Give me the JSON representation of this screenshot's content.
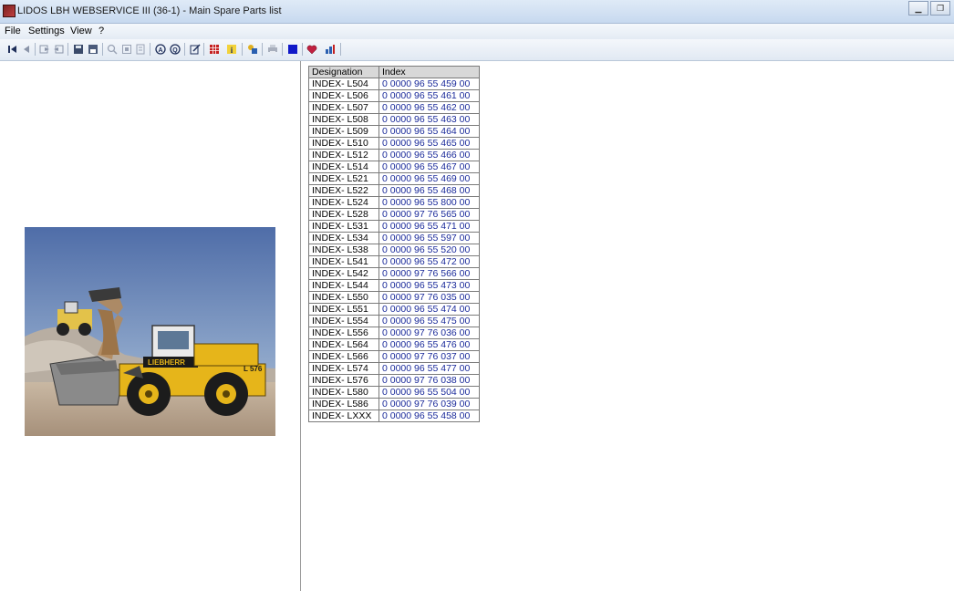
{
  "window": {
    "title": "LIDOS LBH WEBSERVICE III (36-1) - Main Spare Parts list"
  },
  "menu": {
    "file": "File",
    "settings": "Settings",
    "view": "View",
    "help": "?"
  },
  "icons": [
    "first-record-icon",
    "prev-record-icon",
    "export-icon",
    "import-icon",
    "save-icon",
    "floppy-icon",
    "zoom-icon",
    "fit-page-icon",
    "page-icon",
    "search-a-icon",
    "search-b-icon",
    "edit-icon",
    "grid-icon",
    "info-icon",
    "tools-icon",
    "print-icon",
    "stop-icon",
    "favorite-icon",
    "bookmark-icon"
  ],
  "table": {
    "headers": {
      "designation": "Designation",
      "index": "Index"
    },
    "rows": [
      {
        "designation": "INDEX- L504",
        "index": "0 0000  96 55 459 00"
      },
      {
        "designation": "INDEX- L506",
        "index": "0 0000  96 55 461 00"
      },
      {
        "designation": "INDEX- L507",
        "index": "0 0000  96 55 462 00"
      },
      {
        "designation": "INDEX- L508",
        "index": "0 0000  96 55 463 00"
      },
      {
        "designation": "INDEX- L509",
        "index": "0 0000  96 55 464 00"
      },
      {
        "designation": "INDEX- L510",
        "index": "0 0000  96 55 465 00"
      },
      {
        "designation": "INDEX- L512",
        "index": "0 0000  96 55 466 00"
      },
      {
        "designation": "INDEX- L514",
        "index": "0 0000  96 55 467 00"
      },
      {
        "designation": "INDEX- L521",
        "index": "0 0000  96 55 469 00"
      },
      {
        "designation": "INDEX- L522",
        "index": "0 0000  96 55 468 00"
      },
      {
        "designation": "INDEX- L524",
        "index": "0 0000  96 55 800 00"
      },
      {
        "designation": "INDEX- L528",
        "index": "0 0000  97 76 565 00"
      },
      {
        "designation": "INDEX- L531",
        "index": "0 0000  96 55 471 00"
      },
      {
        "designation": "INDEX- L534",
        "index": "0 0000  96 55 597 00"
      },
      {
        "designation": "INDEX- L538",
        "index": "0 0000  96 55 520 00"
      },
      {
        "designation": "INDEX- L541",
        "index": "0 0000  96 55 472 00"
      },
      {
        "designation": "INDEX- L542",
        "index": "0 0000  97 76 566 00"
      },
      {
        "designation": "INDEX- L544",
        "index": "0 0000  96 55 473 00"
      },
      {
        "designation": "INDEX- L550",
        "index": "0 0000  97 76 035 00"
      },
      {
        "designation": "INDEX- L551",
        "index": "0 0000  96 55 474 00"
      },
      {
        "designation": "INDEX- L554",
        "index": "0 0000  96 55 475 00"
      },
      {
        "designation": "INDEX- L556",
        "index": "0 0000  97 76 036 00"
      },
      {
        "designation": "INDEX- L564",
        "index": "0 0000  96 55 476 00"
      },
      {
        "designation": "INDEX- L566",
        "index": "0 0000  97 76 037 00"
      },
      {
        "designation": "INDEX- L574",
        "index": "0 0000  96 55 477 00"
      },
      {
        "designation": "INDEX- L576",
        "index": "0 0000  97 76 038 00"
      },
      {
        "designation": "INDEX- L580",
        "index": "0 0000  96 55 504 00"
      },
      {
        "designation": "INDEX- L586",
        "index": "0 0000  97 76 039 00"
      },
      {
        "designation": "INDEX- LXXX",
        "index": "0 0000  96 55 458 00"
      }
    ]
  }
}
